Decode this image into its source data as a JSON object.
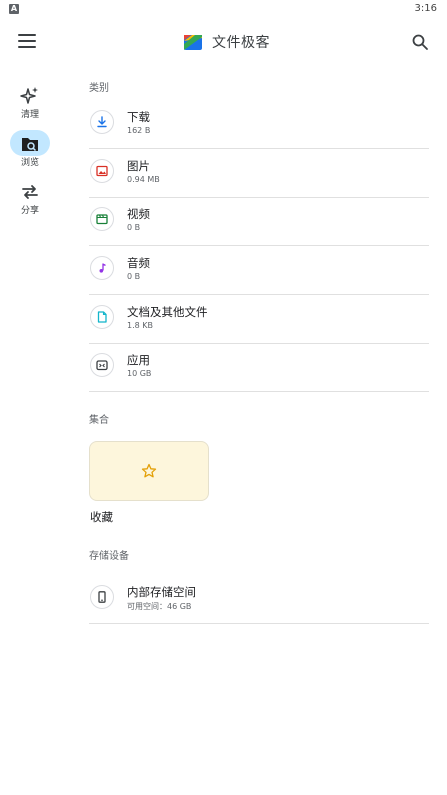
{
  "status_bar": {
    "indicator": "A",
    "time": "3:16"
  },
  "app_bar": {
    "title": "文件极客"
  },
  "rail": [
    {
      "label": "清理",
      "icon": "sparkle-icon"
    },
    {
      "label": "浏览",
      "icon": "browse-folder-icon",
      "active": true
    },
    {
      "label": "分享",
      "icon": "swap-arrows-icon"
    }
  ],
  "sections": {
    "categories": "类别",
    "collections": "集合",
    "storage": "存储设备"
  },
  "categories": [
    {
      "title": "下载",
      "subtitle": "162 B",
      "icon": "download-icon",
      "color": "#1a73e8"
    },
    {
      "title": "图片",
      "subtitle": "0.94 MB",
      "icon": "image-icon",
      "color": "#d93025"
    },
    {
      "title": "视频",
      "subtitle": "0 B",
      "icon": "video-icon",
      "color": "#188038"
    },
    {
      "title": "音频",
      "subtitle": "0 B",
      "icon": "music-note-icon",
      "color": "#9334e6"
    },
    {
      "title": "文档及其他文件",
      "subtitle": "1.8 KB",
      "icon": "document-icon",
      "color": "#12b5cb"
    },
    {
      "title": "应用",
      "subtitle": "10 GB",
      "icon": "app-icon",
      "color": "#3c4043"
    }
  ],
  "collections": {
    "favorites_label": "收藏",
    "icon": "star-icon",
    "color": "#e3a008"
  },
  "storage": {
    "title": "内部存储空间",
    "subtitle": "可用空间：46 GB",
    "icon": "phone-icon"
  }
}
